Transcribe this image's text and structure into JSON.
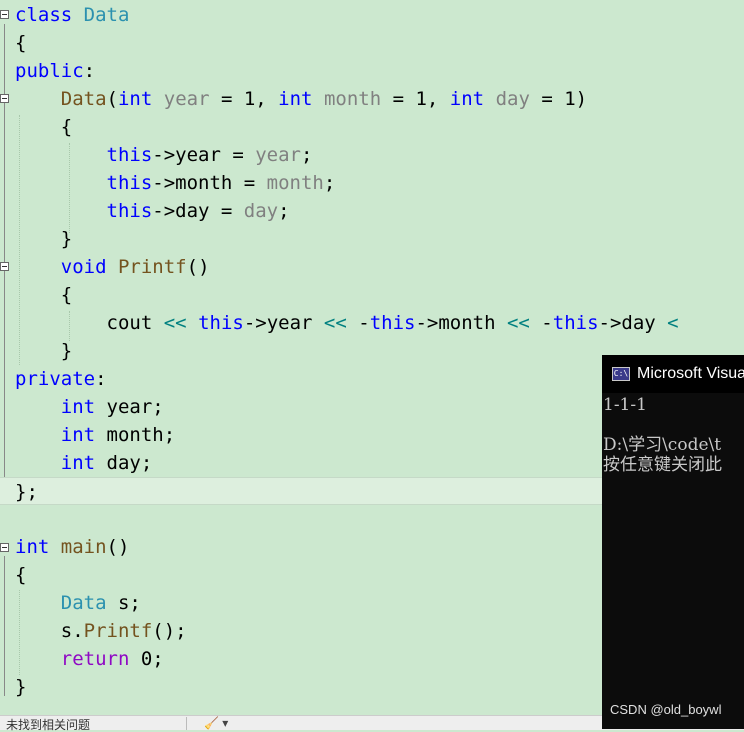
{
  "code": {
    "l1": {
      "kw": "class",
      "type": "Data"
    },
    "l2": "{",
    "l3": {
      "kw": "public",
      "colon": ":"
    },
    "l4": {
      "fn": "Data",
      "open": "(",
      "int": "int",
      "p1": "year",
      "eq1": " = 1, ",
      "p2": "month",
      "eq2": " = 1, ",
      "p3": "day",
      "close": " = 1)"
    },
    "l5": "{",
    "l6": {
      "this": "this",
      "arrow": "->year = ",
      "param": "year",
      "semi": ";"
    },
    "l7": {
      "this": "this",
      "arrow": "->month = ",
      "param": "month",
      "semi": ";"
    },
    "l8": {
      "this": "this",
      "arrow": "->day = ",
      "param": "day",
      "semi": ";"
    },
    "l9": "}",
    "l10": {
      "kw": "void",
      "fn": "Printf",
      "rest": "()"
    },
    "l11": "{",
    "l12": {
      "cout": "cout ",
      "op": "<<",
      "this1": "this",
      "a1": "->year ",
      "dash1": " -",
      "this2": "this",
      "a2": "->month ",
      "dash2": " -",
      "this3": "this",
      "a3": "->day ",
      "op_tail": "<"
    },
    "l13": "}",
    "l14": {
      "kw": "private",
      "colon": ":"
    },
    "l15": {
      "kw": "int",
      "rest": " year;"
    },
    "l16": {
      "kw": "int",
      "rest": " month;"
    },
    "l17": {
      "kw": "int",
      "rest": " day;"
    },
    "l18": "};",
    "l20": {
      "kw": "int",
      "fn": "main",
      "rest": "()"
    },
    "l21": "{",
    "l22": {
      "type": "Data",
      "rest": " s;"
    },
    "l23": {
      "pre": "s.",
      "fn": "Printf",
      "rest": "();"
    },
    "l24": {
      "kw": "return",
      "rest": " 0;"
    },
    "l25": "}"
  },
  "console": {
    "title": "Microsoft Visua",
    "icon": "C:\\",
    "lines": "1-1-1\n\nD:\\学习\\code\\t\n按任意键关闭此",
    "watermark": "CSDN @old_boywl"
  },
  "status": {
    "text": "未找到相关问题",
    "tool": "🧹 ▾"
  }
}
